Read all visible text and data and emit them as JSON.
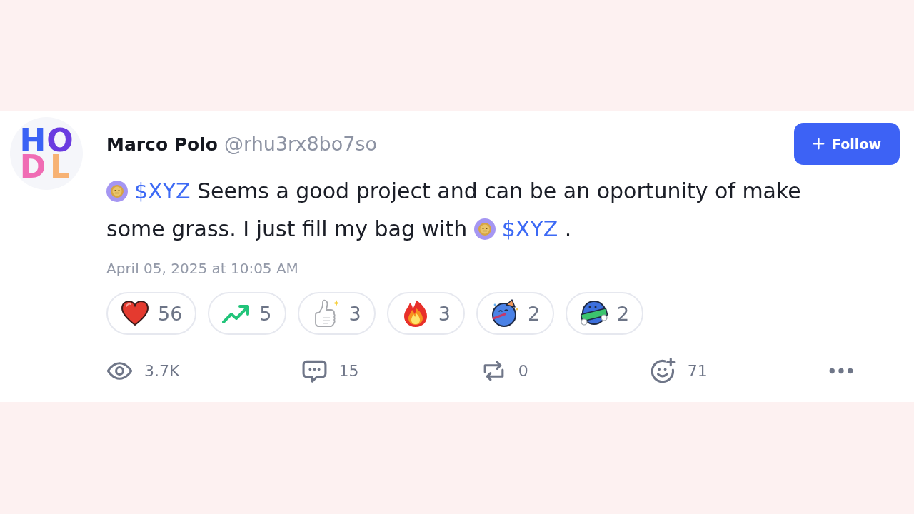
{
  "post": {
    "author": {
      "avatar_letters": [
        {
          "char": "H",
          "color": "#3b62f5"
        },
        {
          "char": "O",
          "color": "#6a3be0"
        },
        {
          "char": "D",
          "color": "#f06cb4"
        },
        {
          "char": "L",
          "color": "#f7b274"
        }
      ],
      "name": "Marco Polo",
      "handle": "@rhu3rx8bo7so"
    },
    "follow_button": {
      "label": "Follow"
    },
    "body": [
      {
        "kind": "token",
        "label": "$XYZ"
      },
      {
        "kind": "text",
        "text": " Seems a good project and can be an oportunity of make some grass. I just fill my bag with "
      },
      {
        "kind": "token",
        "label": "$XYZ"
      },
      {
        "kind": "text",
        "text": " ."
      }
    ],
    "timestamp": "April 05, 2025 at 10:05 AM",
    "reactions": [
      {
        "kind": "heart",
        "count": "56"
      },
      {
        "kind": "trending",
        "count": "5"
      },
      {
        "kind": "thumbs-up",
        "count": "3"
      },
      {
        "kind": "fire",
        "count": "3"
      },
      {
        "kind": "party-blob",
        "count": "2"
      },
      {
        "kind": "banner-blob",
        "count": "2"
      }
    ],
    "stats": [
      {
        "kind": "views",
        "count": "3.7K"
      },
      {
        "kind": "comments",
        "count": "15"
      },
      {
        "kind": "reposts",
        "count": "0"
      },
      {
        "kind": "reactions",
        "count": "71"
      },
      {
        "kind": "more"
      }
    ]
  }
}
